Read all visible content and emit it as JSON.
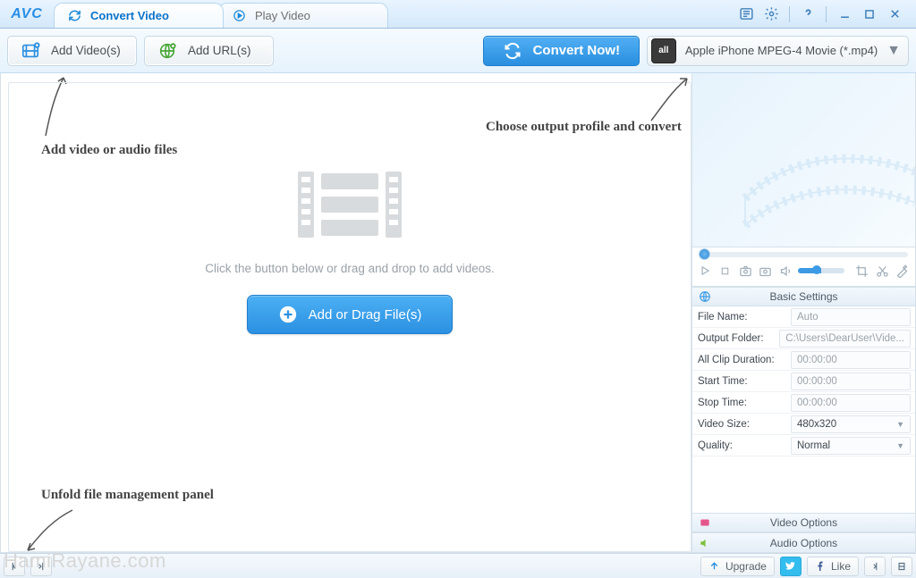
{
  "app": {
    "logo_text": "AVC"
  },
  "tabs": {
    "convert": "Convert Video",
    "play": "Play Video"
  },
  "toolbar": {
    "add_videos": "Add Video(s)",
    "add_urls": "Add URL(s)",
    "convert_now": "Convert Now!",
    "profile_chip": "all",
    "profile_label": "Apple iPhone MPEG-4 Movie (*.mp4)"
  },
  "annotations": {
    "add_files": "Add video or audio files",
    "choose_output": "Choose output profile and convert",
    "unfold_panel": "Unfold file management panel"
  },
  "drop": {
    "hint": "Click the button below or drag and drop to add videos.",
    "button": "Add or Drag File(s)"
  },
  "settings": {
    "header": "Basic Settings",
    "rows": [
      {
        "label": "File Name:",
        "value": "Auto",
        "dropdown": false,
        "filled": false
      },
      {
        "label": "Output Folder:",
        "value": "C:\\Users\\DearUser\\Vide...",
        "dropdown": false,
        "filled": false
      },
      {
        "label": "All Clip Duration:",
        "value": "00:00:00",
        "dropdown": false,
        "filled": false
      },
      {
        "label": "Start Time:",
        "value": "00:00:00",
        "dropdown": false,
        "filled": false
      },
      {
        "label": "Stop Time:",
        "value": "00:00:00",
        "dropdown": false,
        "filled": false
      },
      {
        "label": "Video Size:",
        "value": "480x320",
        "dropdown": true,
        "filled": true
      },
      {
        "label": "Quality:",
        "value": "Normal",
        "dropdown": true,
        "filled": true
      }
    ],
    "video_options": "Video Options",
    "audio_options": "Audio Options"
  },
  "footer": {
    "upgrade": "Upgrade",
    "like": "Like"
  },
  "watermark": "HamiRayane.com"
}
